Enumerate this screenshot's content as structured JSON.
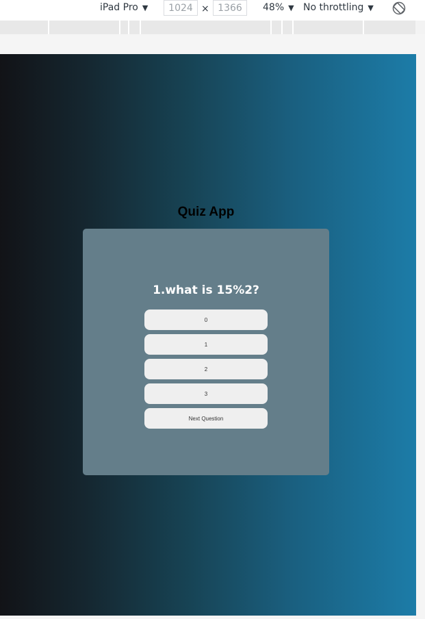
{
  "devtools": {
    "device": "iPad Pro",
    "width_value": "1024",
    "height_value": "1366",
    "separator": "×",
    "zoom": "48%",
    "throttling": "No throttling",
    "caret": "▼"
  },
  "colors": {
    "page_gradient_start": "#121317",
    "page_gradient_end": "#1c7ca8",
    "card_background": "#647e8a",
    "button_background": "#efefef"
  },
  "app": {
    "title": "Quiz App",
    "question": "1.what is 15%2?",
    "answers": [
      "0",
      "1",
      "2",
      "3"
    ],
    "next_label": "Next Question"
  }
}
